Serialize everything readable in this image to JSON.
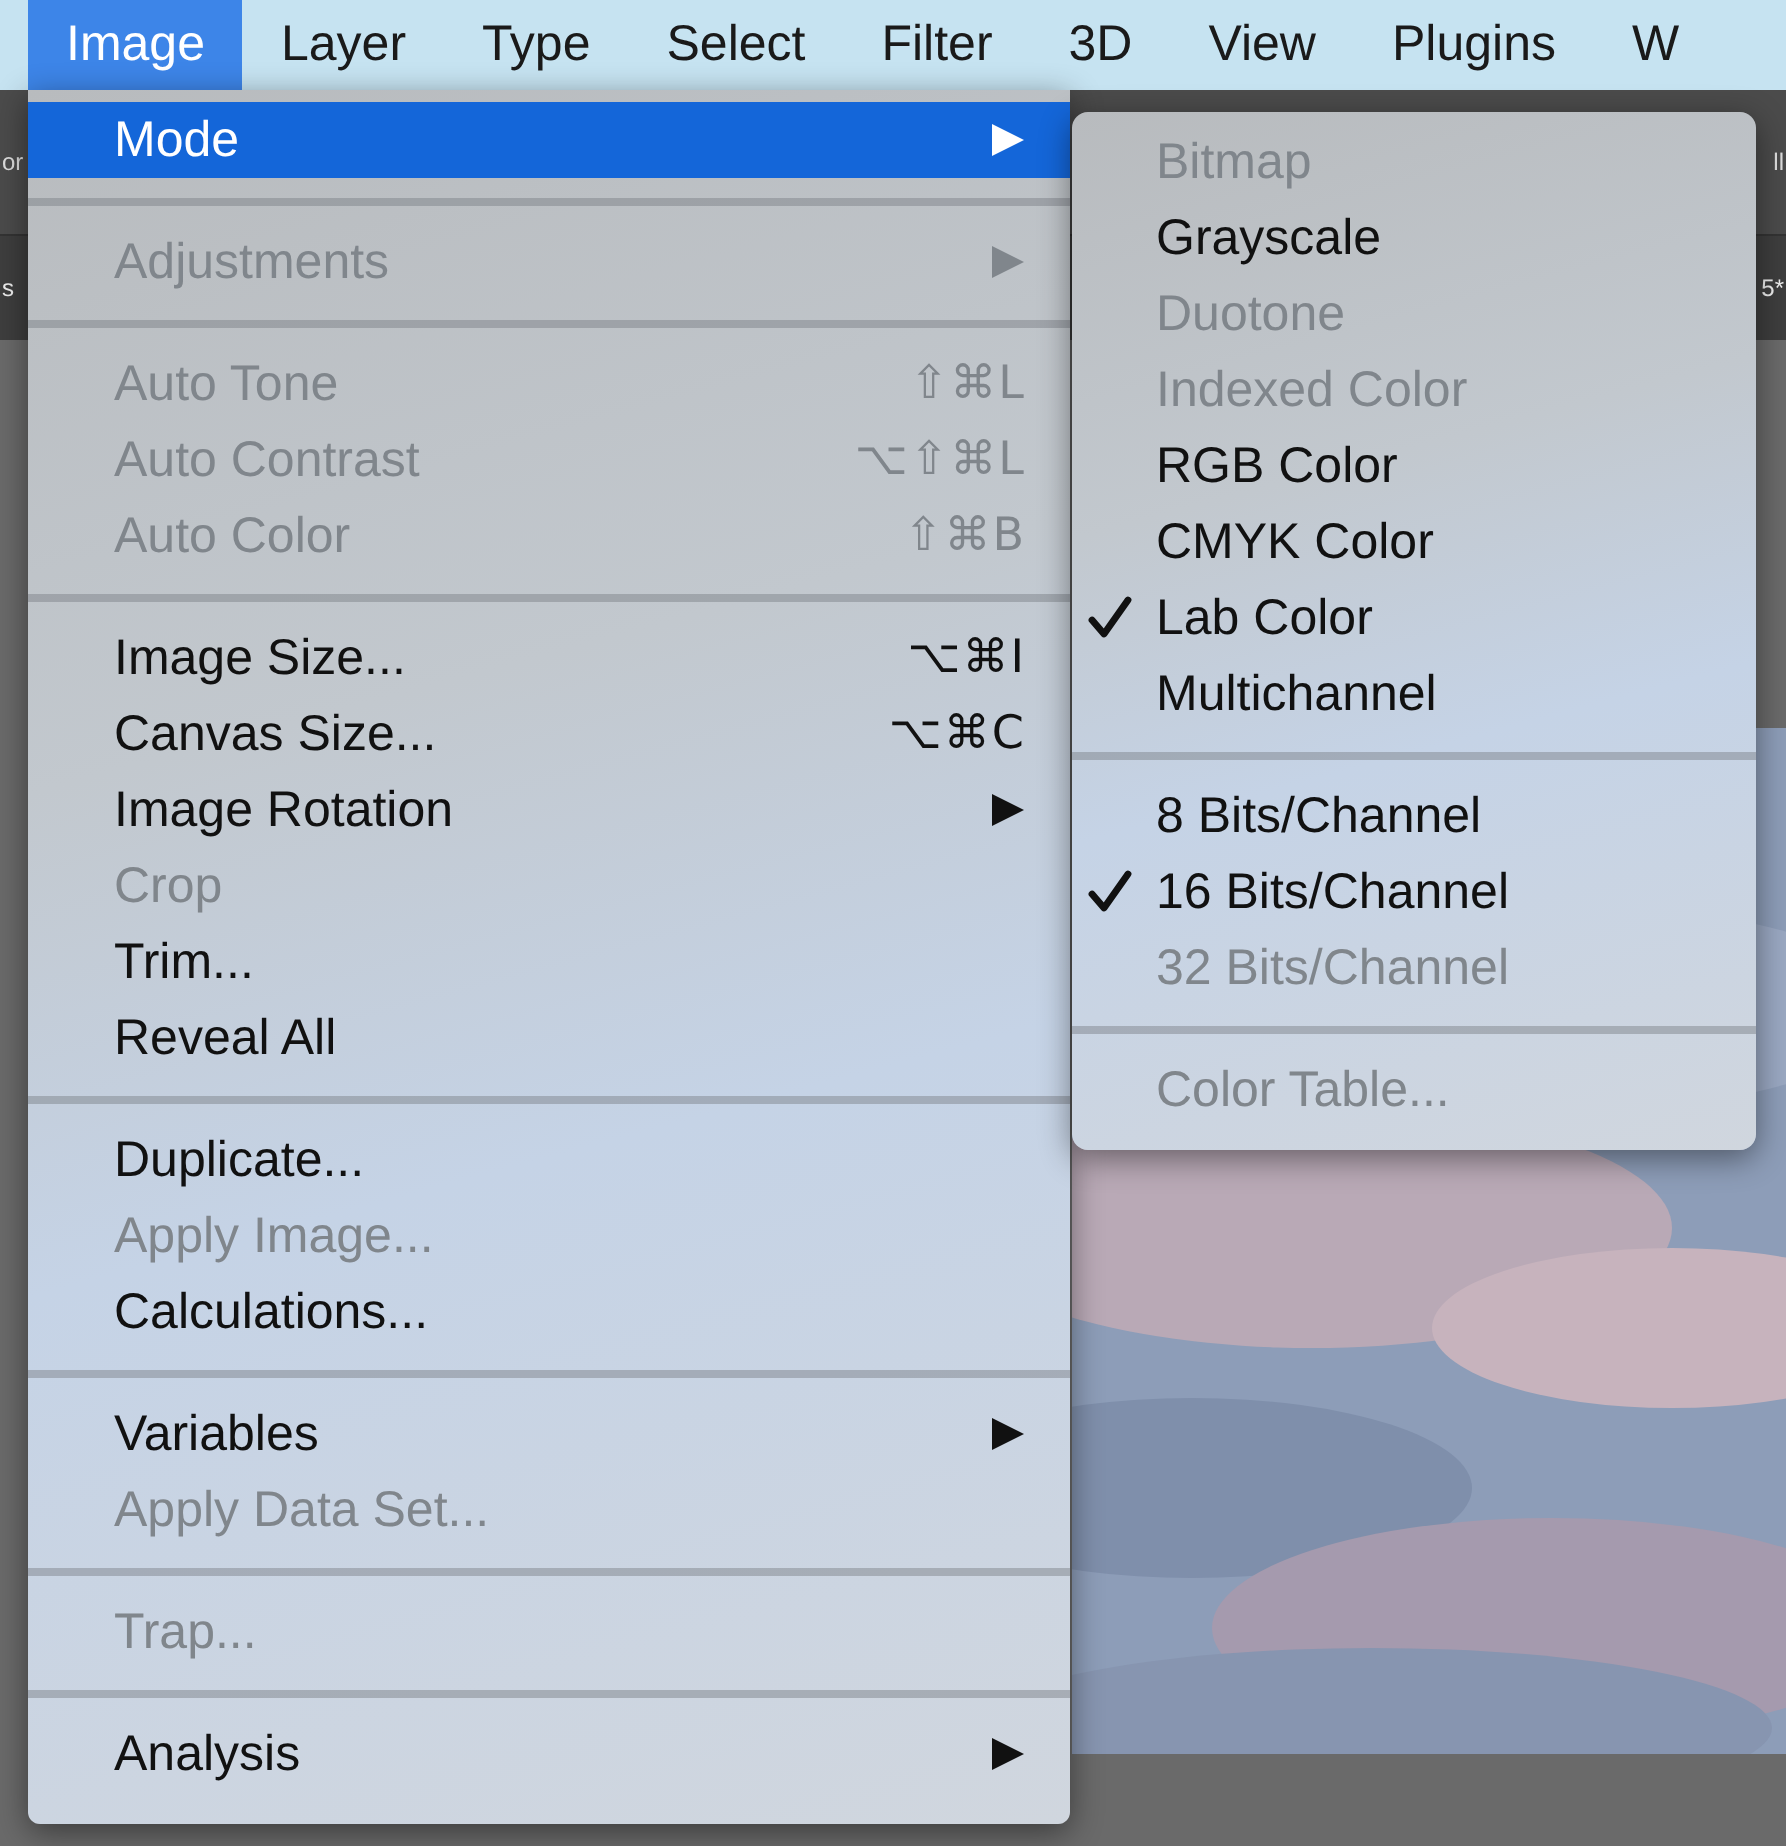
{
  "menu_bar": [
    {
      "label": "Image",
      "selected": true
    },
    {
      "label": "Layer",
      "selected": false
    },
    {
      "label": "Type",
      "selected": false
    },
    {
      "label": "Select",
      "selected": false
    },
    {
      "label": "Filter",
      "selected": false
    },
    {
      "label": "3D",
      "selected": false
    },
    {
      "label": "View",
      "selected": false
    },
    {
      "label": "Plugins",
      "selected": false
    },
    {
      "label": "W",
      "selected": false
    }
  ],
  "background": {
    "options_bar": {
      "left_text": "or",
      "right_text": "ll"
    },
    "document_tabs": {
      "left_text": "s",
      "right_text": "5*"
    }
  },
  "image_menu": [
    {
      "kind": "item",
      "label": "Mode",
      "has_submenu": true,
      "disabled": false,
      "selected": true
    },
    {
      "kind": "separator"
    },
    {
      "kind": "item",
      "label": "Adjustments",
      "has_submenu": true,
      "disabled": true,
      "selected": false
    },
    {
      "kind": "separator"
    },
    {
      "kind": "item",
      "label": "Auto Tone",
      "shortcut": "⇧⌘L",
      "disabled": true,
      "selected": false
    },
    {
      "kind": "item",
      "label": "Auto Contrast",
      "shortcut": "⌥⇧⌘L",
      "disabled": true,
      "selected": false
    },
    {
      "kind": "item",
      "label": "Auto Color",
      "shortcut": "⇧⌘B",
      "disabled": true,
      "selected": false
    },
    {
      "kind": "separator"
    },
    {
      "kind": "item",
      "label": "Image Size...",
      "shortcut": "⌥⌘I",
      "disabled": false,
      "selected": false
    },
    {
      "kind": "item",
      "label": "Canvas Size...",
      "shortcut": "⌥⌘C",
      "disabled": false,
      "selected": false
    },
    {
      "kind": "item",
      "label": "Image Rotation",
      "has_submenu": true,
      "disabled": false,
      "selected": false
    },
    {
      "kind": "item",
      "label": "Crop",
      "disabled": true,
      "selected": false
    },
    {
      "kind": "item",
      "label": "Trim...",
      "disabled": false,
      "selected": false
    },
    {
      "kind": "item",
      "label": "Reveal All",
      "disabled": false,
      "selected": false
    },
    {
      "kind": "separator"
    },
    {
      "kind": "item",
      "label": "Duplicate...",
      "disabled": false,
      "selected": false
    },
    {
      "kind": "item",
      "label": "Apply Image...",
      "disabled": true,
      "selected": false
    },
    {
      "kind": "item",
      "label": "Calculations...",
      "disabled": false,
      "selected": false
    },
    {
      "kind": "separator"
    },
    {
      "kind": "item",
      "label": "Variables",
      "has_submenu": true,
      "disabled": false,
      "selected": false
    },
    {
      "kind": "item",
      "label": "Apply Data Set...",
      "disabled": true,
      "selected": false
    },
    {
      "kind": "separator"
    },
    {
      "kind": "item",
      "label": "Trap...",
      "disabled": true,
      "selected": false
    },
    {
      "kind": "separator"
    },
    {
      "kind": "item",
      "label": "Analysis",
      "has_submenu": true,
      "disabled": false,
      "selected": false
    }
  ],
  "mode_submenu": [
    {
      "kind": "item",
      "label": "Bitmap",
      "checked": false,
      "disabled": true
    },
    {
      "kind": "item",
      "label": "Grayscale",
      "checked": false,
      "disabled": false
    },
    {
      "kind": "item",
      "label": "Duotone",
      "checked": false,
      "disabled": true
    },
    {
      "kind": "item",
      "label": "Indexed Color",
      "checked": false,
      "disabled": true
    },
    {
      "kind": "item",
      "label": "RGB Color",
      "checked": false,
      "disabled": false
    },
    {
      "kind": "item",
      "label": "CMYK Color",
      "checked": false,
      "disabled": false
    },
    {
      "kind": "item",
      "label": "Lab Color",
      "checked": true,
      "disabled": false
    },
    {
      "kind": "item",
      "label": "Multichannel",
      "checked": false,
      "disabled": false
    },
    {
      "kind": "separator"
    },
    {
      "kind": "item",
      "label": "8 Bits/Channel",
      "checked": false,
      "disabled": false
    },
    {
      "kind": "item",
      "label": "16 Bits/Channel",
      "checked": true,
      "disabled": false
    },
    {
      "kind": "item",
      "label": "32 Bits/Channel",
      "checked": false,
      "disabled": true
    },
    {
      "kind": "separator"
    },
    {
      "kind": "item",
      "label": "Color Table...",
      "checked": false,
      "disabled": true
    }
  ]
}
